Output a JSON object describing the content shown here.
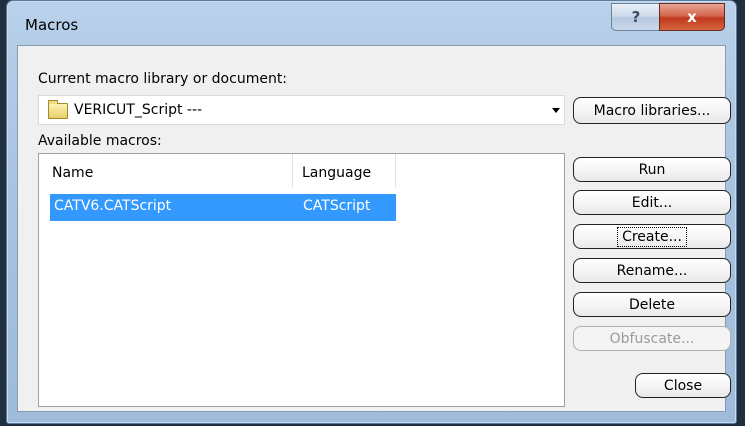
{
  "window": {
    "title": "Macros",
    "help_glyph": "?",
    "close_glyph": "x"
  },
  "library": {
    "label": "Current macro library or document:",
    "value": "VERICUT_Script   ---",
    "icon": "folder-icon",
    "libraries_button": "Macro libraries..."
  },
  "macros": {
    "label": "Available macros:",
    "columns": [
      "Name",
      "Language"
    ],
    "rows": [
      {
        "name": "CATV6.CATScript",
        "language": "CATScript",
        "selected": true
      }
    ]
  },
  "buttons": {
    "run": "Run",
    "edit": "Edit...",
    "create": "Create...",
    "rename": "Rename...",
    "delete": "Delete",
    "obfuscate": "Obfuscate...",
    "close": "Close"
  },
  "colors": {
    "selection": "#3399ff",
    "close_button": "#c0391f"
  }
}
